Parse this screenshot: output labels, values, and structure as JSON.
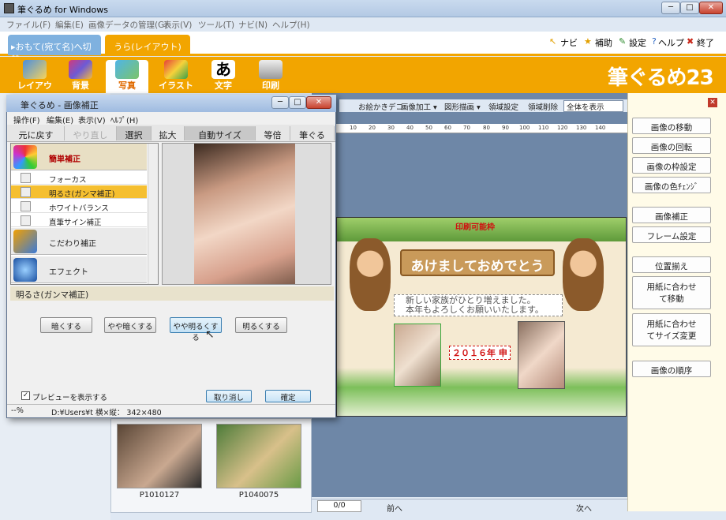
{
  "app": {
    "title": "筆ぐるめ for Windows",
    "win_min": "─",
    "win_max": "□",
    "win_close": "✕"
  },
  "menu": [
    "ファイル(F)",
    "編集(E)",
    "画像データの管理(G)",
    "表示(V)",
    "ツール(T)",
    "ナビ(N)",
    "ヘルプ(H)"
  ],
  "tabs": {
    "omote": "▸おもて(宛て名)へ切替",
    "ura": "うら(レイアウト)"
  },
  "toplinks": {
    "navi": "ナビ",
    "hojo": "補助",
    "settei": "設定",
    "help": "ヘルプ",
    "exit": "終了"
  },
  "modes": [
    "レイアウト",
    "背景",
    "写真",
    "イラスト",
    "文字",
    "印刷"
  ],
  "logo": "筆ぐるめ23",
  "canvas_tools": {
    "deco": "お絵かきデコ",
    "kakou": "画像加工 ▾",
    "zukei": "図形描画 ▾",
    "area_set": "領域設定",
    "area_del": "領域削除",
    "view": "全体を表示"
  },
  "ruler": [
    "10",
    "20",
    "30",
    "40",
    "50",
    "60",
    "70",
    "80",
    "90",
    "100",
    "110",
    "120",
    "130",
    "140"
  ],
  "card": {
    "print_area": "印刷可能枠",
    "greeting": "あけましておめでとう",
    "line1": "新しい家族がひとり増えました。",
    "line2": "本年もよろしくお願いいたします。",
    "year": "２０１６年 申"
  },
  "right_buttons": [
    "画像の移動",
    "画像の回転",
    "画像の枠設定",
    "画像の色ﾁｪﾝｼﾞ",
    "画像補正",
    "フレーム設定",
    "位置揃え",
    "用紙に合わせて移動",
    "用紙に合わせてサイズ変更",
    "画像の順序"
  ],
  "thumbs": [
    {
      "caption": "P1010127"
    },
    {
      "caption": "P1040075"
    }
  ],
  "pager": {
    "value": "0/0",
    "prev": "前へ",
    "next": "次へ"
  },
  "dialog": {
    "title": "筆ぐるめ - 画像補正",
    "menu": [
      "操作(F)",
      "編集(E)",
      "表示(V)",
      "ﾍﾙﾌﾟ(H)"
    ],
    "tools": [
      "元に戻す",
      "やり直し",
      "選択",
      "拡大",
      "自動サイズ",
      "等倍",
      "筆ぐる"
    ],
    "categories": {
      "easy": "簡単補正",
      "kodawari": "こだわり補正",
      "effect": "エフェクト"
    },
    "subitems": [
      "フォーカス",
      "明るさ(ガンマ補正)",
      "ホワイトバランス",
      "直筆サイン補正"
    ],
    "section": "明るさ(ガンマ補正)",
    "bright_buttons": [
      "暗くする",
      "やや暗くする",
      "やや明るくする",
      "明るくする"
    ],
    "preview_check": "プレビューを表示する",
    "cancel": "取り消し",
    "ok": "確定",
    "status_zoom": "--%",
    "status_path": "D:¥Users¥t 横×縦：  342×480"
  }
}
